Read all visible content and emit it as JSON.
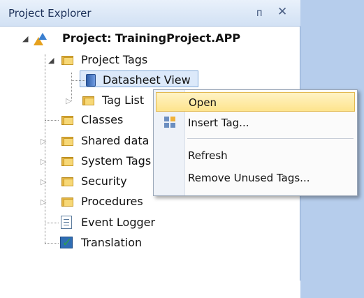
{
  "panel": {
    "title": "Project Explorer",
    "pin_glyph": "ᴨ",
    "close_glyph": "✕"
  },
  "tree": {
    "project": "Project: TrainingProject.APP",
    "project_tags": "Project Tags",
    "datasheet_view": "Datasheet View",
    "tag_list": "Tag List",
    "classes": "Classes",
    "shared_data": "Shared data",
    "system_tags": "System Tags",
    "security": "Security",
    "procedures": "Procedures",
    "event_logger": "Event Logger",
    "translation": "Translation"
  },
  "context_menu": {
    "open": "Open",
    "insert_tag": "Insert Tag...",
    "refresh": "Refresh",
    "remove_unused_tags": "Remove Unused Tags..."
  },
  "colors": {
    "accent": "#b6cdec",
    "highlight": "#fde48d",
    "selection": "#dce9fa"
  }
}
